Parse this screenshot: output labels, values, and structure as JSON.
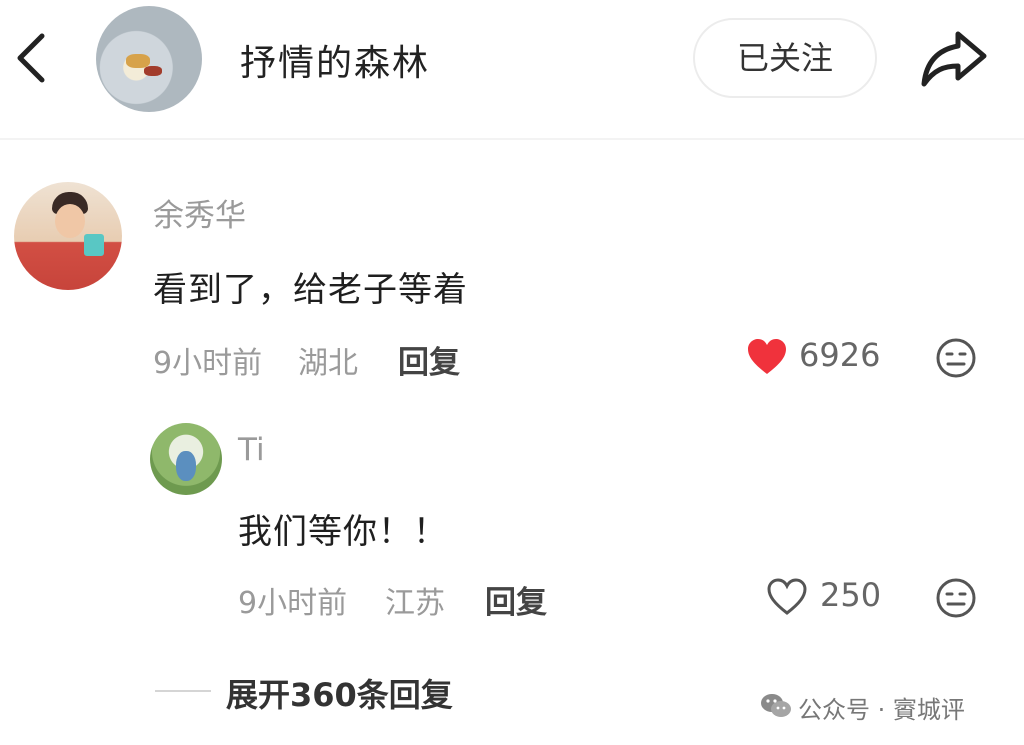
{
  "header": {
    "back_icon": "chevron-left-icon",
    "title": "抒情的森林",
    "follow_label": "已关注",
    "share_icon": "share-arrow-icon"
  },
  "comment": {
    "username": "余秀华",
    "text": "看到了，给老子等着",
    "time": "9小时前",
    "location": "湖北",
    "reply_label": "回复",
    "likes": "6926",
    "liked": true,
    "like_color": "#f0323c"
  },
  "reply": {
    "username": "Ti",
    "text": "我们等你！！",
    "time": "9小时前",
    "location": "江苏",
    "reply_label": "回复",
    "likes": "250",
    "liked": false
  },
  "expand": {
    "label": "展开360条回复"
  },
  "watermark": {
    "text": "公众号 · 賨城评"
  }
}
